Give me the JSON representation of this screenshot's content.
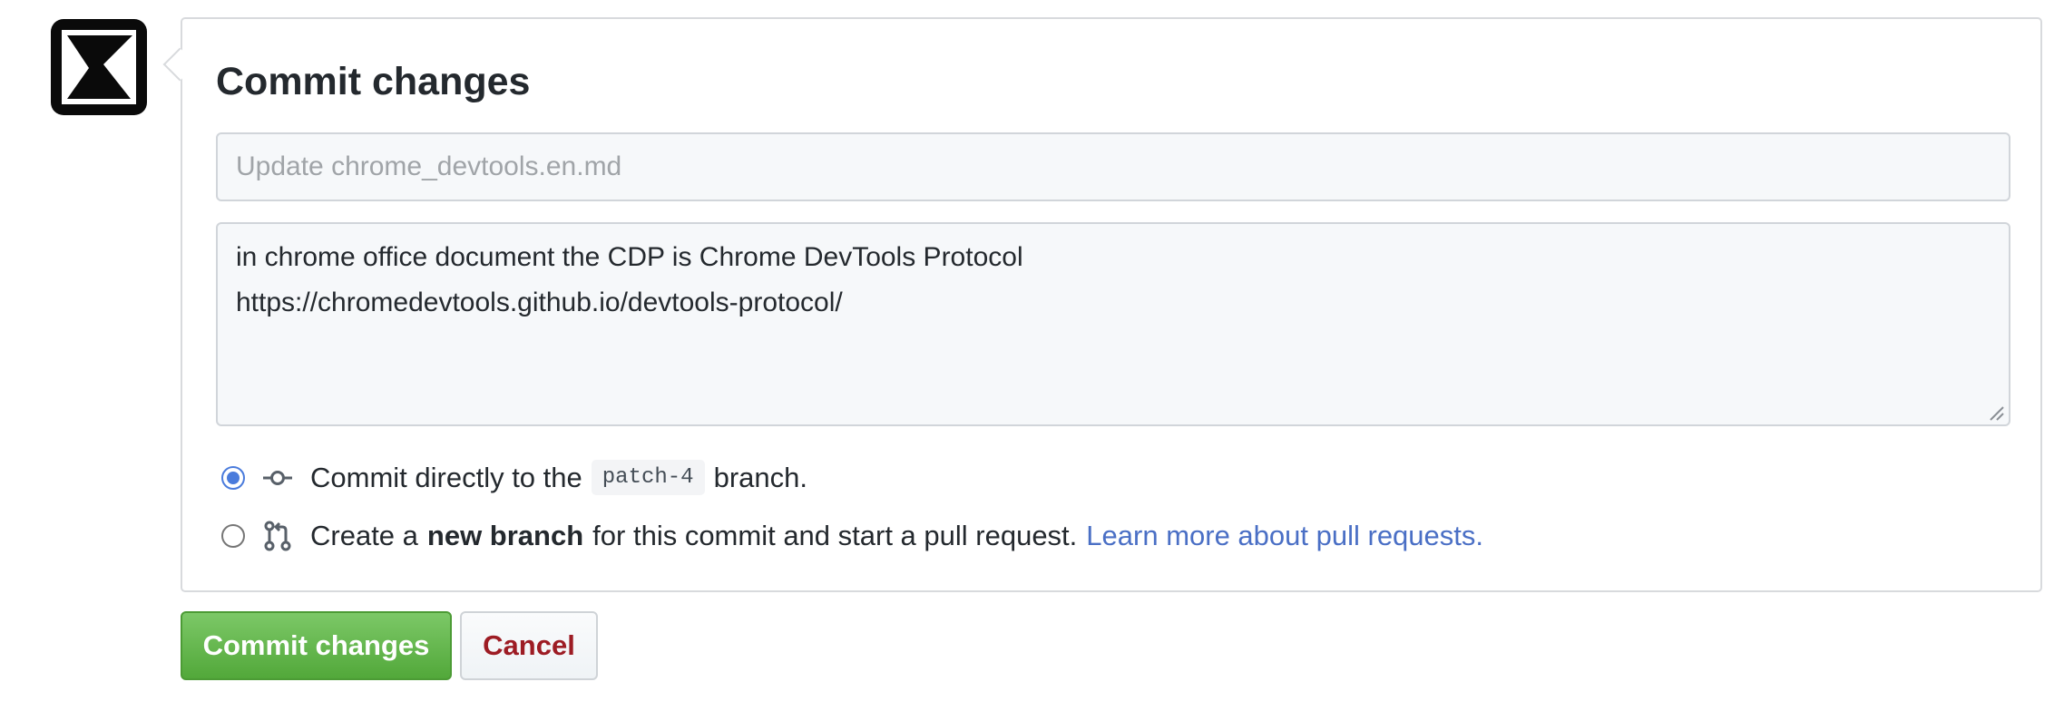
{
  "form": {
    "title": "Commit changes",
    "summary_placeholder": "Update chrome_devtools.en.md",
    "summary_value": "",
    "description_lines": [
      "in chrome office document the CDP is Chrome DevTools Protocol",
      "https://chromedevtools.github.io/devtools-protocol/"
    ]
  },
  "options": {
    "direct": {
      "prefix": "Commit directly to the",
      "branch": "patch-4",
      "suffix": "branch.",
      "selected": true,
      "icon": "git-commit-icon"
    },
    "new_branch": {
      "prefix": "Create a",
      "bold": "new branch",
      "suffix": "for this commit and start a pull request.",
      "link": "Learn more about pull requests.",
      "selected": false,
      "icon": "git-pull-request-icon"
    }
  },
  "buttons": {
    "commit": "Commit changes",
    "cancel": "Cancel"
  },
  "colors": {
    "commit_button": "#5cb544",
    "cancel_text": "#9d1c24",
    "link": "#4a6fc5",
    "radio_selected": "#4a7bdc"
  }
}
